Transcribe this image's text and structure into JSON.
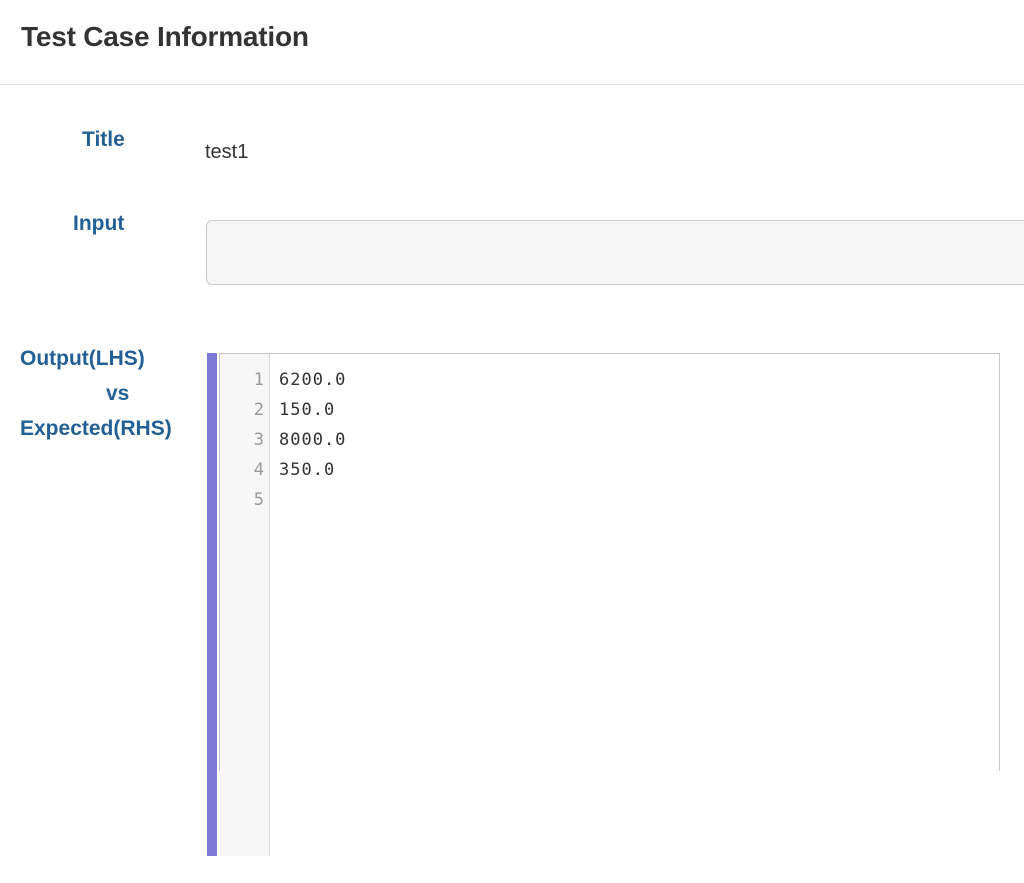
{
  "header": {
    "title": "Test Case Information"
  },
  "fields": {
    "title_label": "Title",
    "title_value": "test1",
    "input_label": "Input",
    "input_value": "",
    "output_label_line1": "Output(LHS)",
    "output_label_line2": "vs",
    "output_label_line3": "Expected(RHS)"
  },
  "editor": {
    "accent_color": "#7b78d6",
    "line_numbers": [
      "1",
      "2",
      "3",
      "4",
      "5"
    ],
    "lines": [
      "6200.0",
      "150.0",
      "8000.0",
      "350.0",
      ""
    ]
  }
}
